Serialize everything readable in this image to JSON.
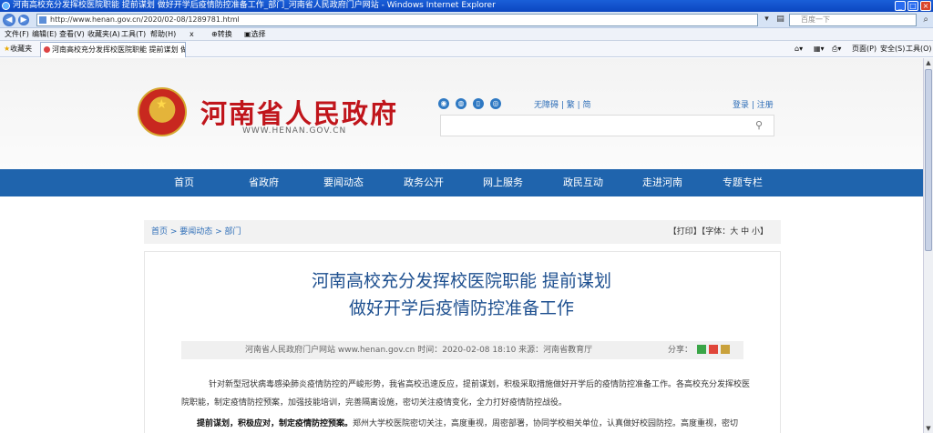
{
  "browser": {
    "window_title": "河南高校充分发挥校医院职能 提前谋划 做好开学后疫情防控准备工作_部门_河南省人民政府门户网站 - Windows Internet Explorer",
    "address": "http://www.henan.gov.cn/2020/02-08/1289781.html",
    "search_placeholder": "百度一下",
    "menu": [
      "文件(F)",
      "编辑(E)",
      "查看(V)",
      "收藏夹(A)",
      "工具(T)",
      "帮助(H)",
      "x",
      "转换",
      "选择"
    ],
    "favorites_label": "收藏夹",
    "tab_title": "河南高校充分发挥校医院职能 提前谋划 做好...",
    "tools": [
      "页面(P)",
      "安全(S)",
      "工具(O)"
    ]
  },
  "site": {
    "title": "河南省人民政府",
    "domain": "WWW.HENAN.GOV.CN",
    "access_links": "无障碍 | 繁 | 简",
    "login_links": "登录 | 注册",
    "nav": [
      "首页",
      "省政府",
      "要闻动态",
      "政务公开",
      "网上服务",
      "政民互动",
      "走进河南",
      "专题专栏"
    ]
  },
  "breadcrumb": {
    "path": "首页 > 要闻动态 > 部门",
    "tools": "【打印】【字体：大 中 小】"
  },
  "article": {
    "title_line1": "河南高校充分发挥校医院职能 提前谋划",
    "title_line2": "做好开学后疫情防控准备工作",
    "meta": "河南省人民政府门户网站 www.henan.gov.cn   时间：2020-02-08 18:10   来源：河南省教育厅",
    "share_label": "分享：",
    "para1_line1": "针对新型冠状病毒感染肺炎疫情防控的严峻形势，我省高校迅速反应，提前谋划，积极采取措施做好开学后的疫情防控准备工作。各高校充分发挥校医",
    "para1_line2": "院职能，制定疫情防控预案，加强技能培训，完善隔离设施，密切关注疫情变化，全力打好疫情防控战役。",
    "para2_bold": "提前谋划，积极应对，制定疫情防控预案。",
    "para2_rest": "郑州大学校医院密切关注，高度重视，周密部署，协同学校相关单位，认真做好校园防控。高度重视，密切"
  },
  "colors": {
    "nav_bg": "#1f64ad",
    "title_red": "#c0151b",
    "article_title": "#1d4f8f"
  }
}
